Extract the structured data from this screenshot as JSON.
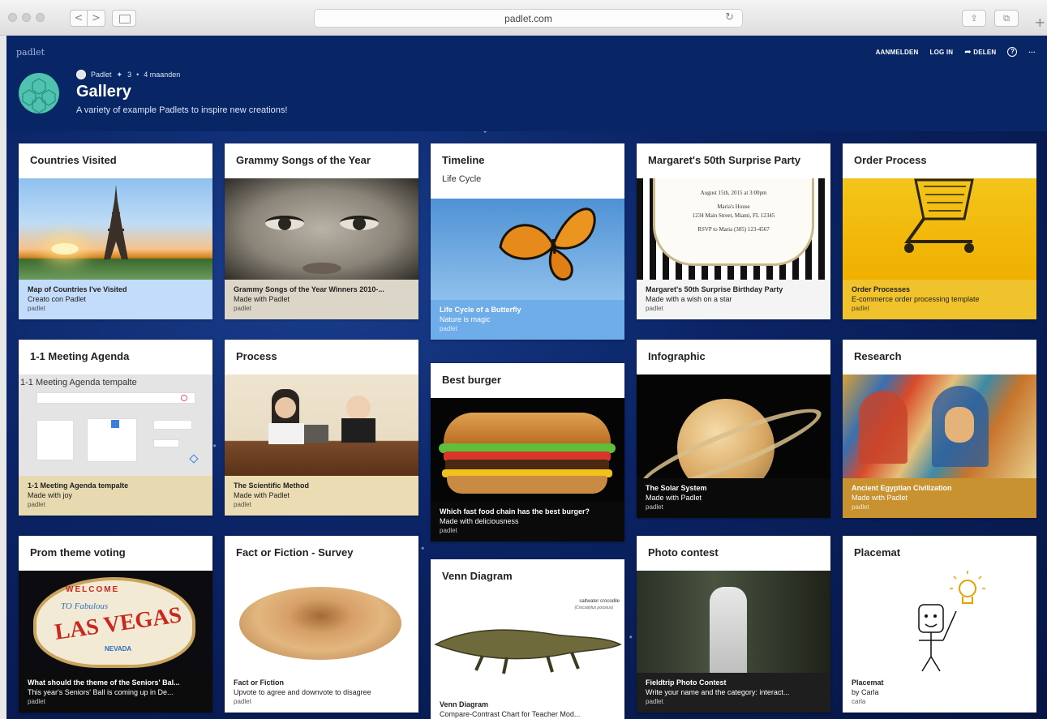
{
  "browser": {
    "url": "padlet.com",
    "back_icon": "<",
    "forward_icon": ">",
    "reload_icon": "↻",
    "share_icon": "⇪",
    "tabs_icon": "⧉",
    "new_tab_icon": "+"
  },
  "header": {
    "brand": "padlet",
    "actions": {
      "signup": "AANMELDEN",
      "login": "LOG IN",
      "share": "DELEN",
      "share_icon": "➦",
      "help": "?",
      "more": "···"
    },
    "meta": {
      "author": "Padlet",
      "separator1": "✦",
      "count": "3",
      "separator2": "•",
      "age": "4 maanden"
    },
    "title": "Gallery",
    "subtitle": "A variety of example Padlets to inspire new creations!"
  },
  "cards": {
    "countries": {
      "title": "Countries Visited",
      "cap_title": "Map of Countries I've Visited",
      "cap_sub": "Creato con Padlet",
      "cap_author": "padlet",
      "cap_bg": "#c4dcfb",
      "cap_fg": "#222222"
    },
    "grammy": {
      "title": "Grammy Songs of the Year",
      "cap_title": "Grammy Songs of the Year Winners 2010-...",
      "cap_sub": "Made with Padlet",
      "cap_author": "padlet",
      "cap_bg": "#dcd6c8",
      "cap_fg": "#222222"
    },
    "timeline": {
      "title": "Timeline",
      "subtitle": "Life Cycle",
      "cap_title": "Life Cycle of a Butterfly",
      "cap_sub": "Nature is magic",
      "cap_author": "padlet",
      "cap_bg": "#6fadea",
      "cap_fg": "#ffffff"
    },
    "margaret": {
      "title": "Margaret's 50th Surprise Party",
      "invite_lines": [
        "August 15th, 2015 at 3:00pm",
        "Maria's House",
        "1234 Main Street, Miami, FL 12345",
        "RSVP to Maria (305) 123-4567"
      ],
      "cap_title": "Margaret's 50th Surprise Birthday Party",
      "cap_sub": "Made with a wish on a star",
      "cap_author": "padlet",
      "cap_bg": "#f4f4f4",
      "cap_fg": "#222222"
    },
    "order": {
      "title": "Order Process",
      "cap_title": "Order Processes",
      "cap_sub": "E-commerce order processing template",
      "cap_author": "padlet",
      "cap_bg": "#f0c22c",
      "cap_fg": "#222222"
    },
    "meeting": {
      "title": "1-1 Meeting Agenda",
      "img_title": "1-1 Meeting Agenda tempalte",
      "cap_title": "1-1 Meeting Agenda tempalte",
      "cap_sub": "Made with joy",
      "cap_author": "padlet",
      "cap_bg": "#e7d9b0",
      "cap_fg": "#222222"
    },
    "process": {
      "title": "Process",
      "cap_title": "The Scientific Method",
      "cap_sub": "Made with Padlet",
      "cap_author": "padlet",
      "cap_bg": "#ecdcb4",
      "cap_fg": "#222222"
    },
    "burger": {
      "title": "Best burger",
      "cap_title": "Which fast food chain has the best burger?",
      "cap_sub": "Made with deliciousness",
      "cap_author": "padlet",
      "cap_bg": "#0a0a0a",
      "cap_fg": "#ffffff"
    },
    "infographic": {
      "title": "Infographic",
      "cap_title": "The Solar System",
      "cap_sub": "Made with Padlet",
      "cap_author": "padlet",
      "cap_bg": "#0a0a0a",
      "cap_fg": "#ffffff"
    },
    "research": {
      "title": "Research",
      "cap_title": "Ancient Egyptian Civilization",
      "cap_sub": "Made with Padlet",
      "cap_author": "padlet",
      "cap_bg": "#c7922f",
      "cap_fg": "#ffffff"
    },
    "prom": {
      "title": "Prom theme voting",
      "sign_top": "WELCOME",
      "sign_to": "TO Fabulous",
      "sign_main": "LAS VEGAS",
      "sign_bottom": "NEVADA",
      "cap_title": "What should the theme of the Seniors' Bal...",
      "cap_sub": "This year's Seniors' Ball is coming up in De...",
      "cap_author": "padlet",
      "cap_bg": "#0c0c0c",
      "cap_fg": "#ffffff"
    },
    "fact": {
      "title": "Fact or Fiction - Survey",
      "cap_title": "Fact or Fiction",
      "cap_sub": "Upvote to agree and downvote to disagree",
      "cap_author": "padlet",
      "cap_bg": "#ffffff",
      "cap_fg": "#222222"
    },
    "venn": {
      "title": "Venn Diagram",
      "img_label": "saltwater crocodile",
      "img_label2": "(Crocodylus porosus)",
      "cap_title": "Venn Diagram",
      "cap_sub": "Compare-Contrast Chart for Teacher Mod...",
      "cap_author": "padlet",
      "cap_bg": "#ffffff",
      "cap_fg": "#222222"
    },
    "photo": {
      "title": "Photo contest",
      "cap_title": "Fieldtrip Photo Contest",
      "cap_sub": "Write your name and the category: interact...",
      "cap_author": "padlet",
      "cap_bg": "#1e1e1e",
      "cap_fg": "#ffffff"
    },
    "placemat": {
      "title": "Placemat",
      "cap_title": "Placemat",
      "cap_sub": "by Carla",
      "cap_author": "carla",
      "cap_bg": "#ffffff",
      "cap_fg": "#222222"
    }
  },
  "colors": {
    "header_bg": "#082666",
    "wall_bg": "#0b2466",
    "avatar": "#4fc2b0"
  }
}
